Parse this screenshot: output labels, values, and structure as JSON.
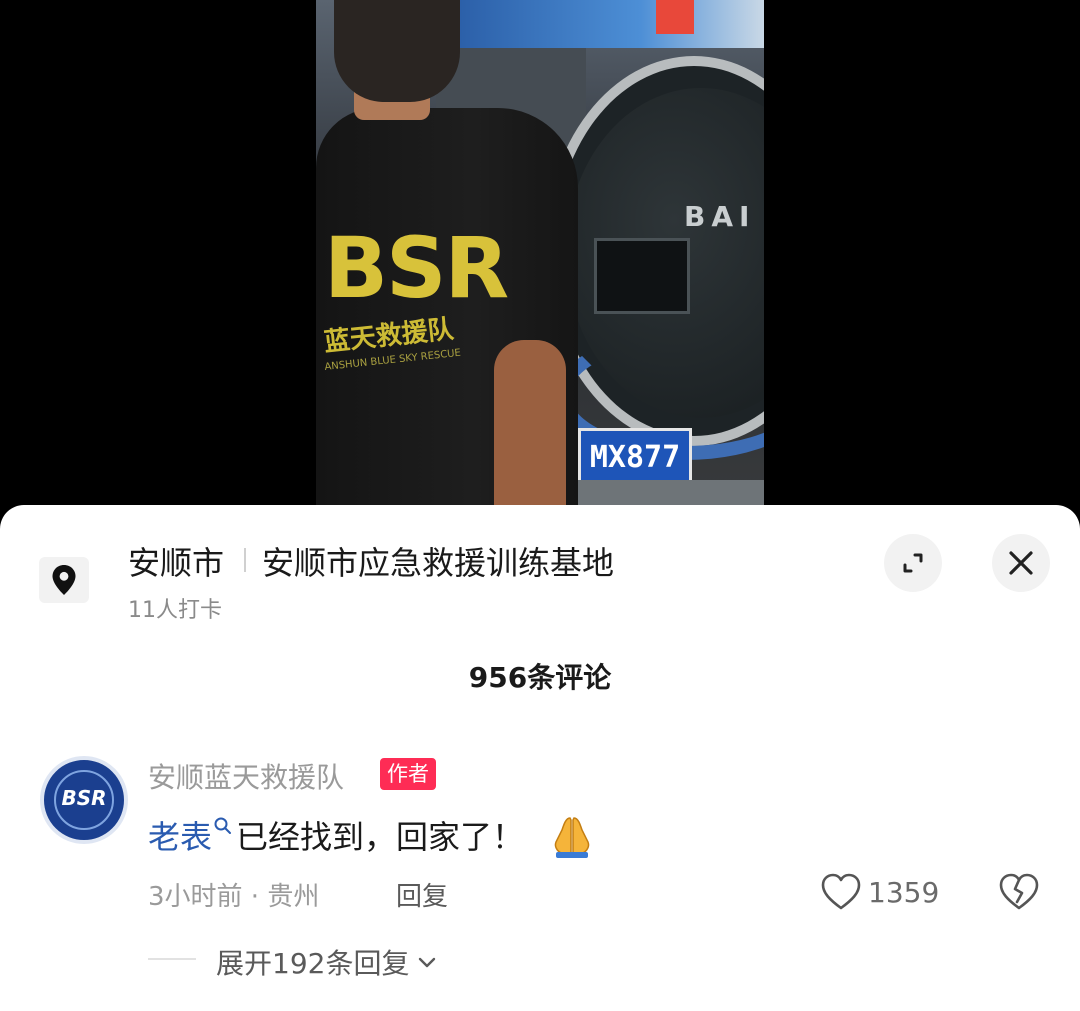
{
  "video": {
    "shirt_logo": "BSR",
    "shirt_team_name": "蓝天救援队",
    "shirt_sub": "ANSHUN BLUE SKY RESCUE",
    "tyre_brand": "BAI",
    "license_plate": "MX877"
  },
  "location": {
    "city": "安顺市",
    "place": "安顺市应急救援训练基地",
    "checkins": "11人打卡",
    "icon": "location-pin-icon"
  },
  "controls": {
    "expand_icon": "expand-icon",
    "close_icon": "close-icon"
  },
  "comments_header": {
    "count_label": "956条评论"
  },
  "comment": {
    "avatar_text": "BSR",
    "author": "安顺蓝天救援队",
    "author_badge": "作者",
    "keyword": "老表",
    "text": "已经找到，回家了！",
    "emoji": "🙏",
    "meta": "3小时前 · 贵州",
    "reply_label": "回复",
    "like_count": "1359",
    "expand_replies": "展开192条回复"
  },
  "colors": {
    "badge": "#fe2c55",
    "keyword": "#2a5bb0",
    "avatar_bg": "#1b3f8f"
  }
}
